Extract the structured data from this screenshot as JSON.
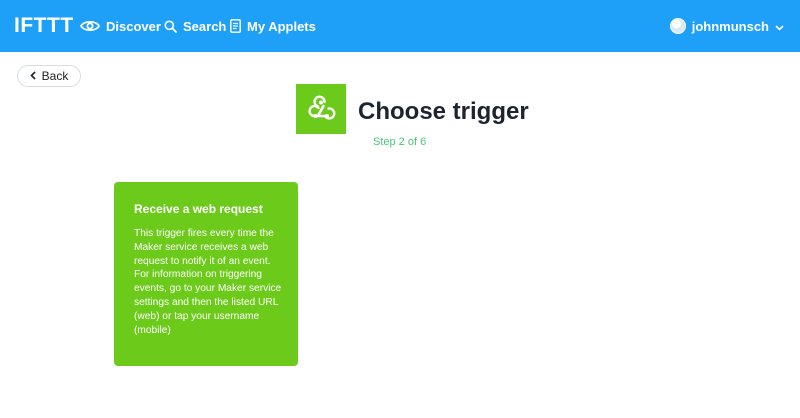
{
  "header": {
    "logo": "IFTTT",
    "nav": [
      {
        "label": "Discover",
        "icon": "eye-icon"
      },
      {
        "label": "Search",
        "icon": "search-icon"
      },
      {
        "label": "My Applets",
        "icon": "document-icon"
      }
    ],
    "user": {
      "name": "johnmunsch",
      "icon": "chevron-down-icon"
    }
  },
  "back_label": "Back",
  "title": "Choose trigger",
  "step": "Step 2 of 6",
  "service": {
    "icon": "webhooks-icon",
    "color": "#6ccb1a"
  },
  "triggers": [
    {
      "title": "Receive a web request",
      "description": "This trigger fires every time the Maker service receives a web request to notify it of an event. For information on triggering events, go to your Maker service settings and then the listed URL (web) or tap your username (mobile)"
    }
  ],
  "colors": {
    "header": "#1fa0f8",
    "accent": "#6ccb1a",
    "step": "#47c77a"
  }
}
